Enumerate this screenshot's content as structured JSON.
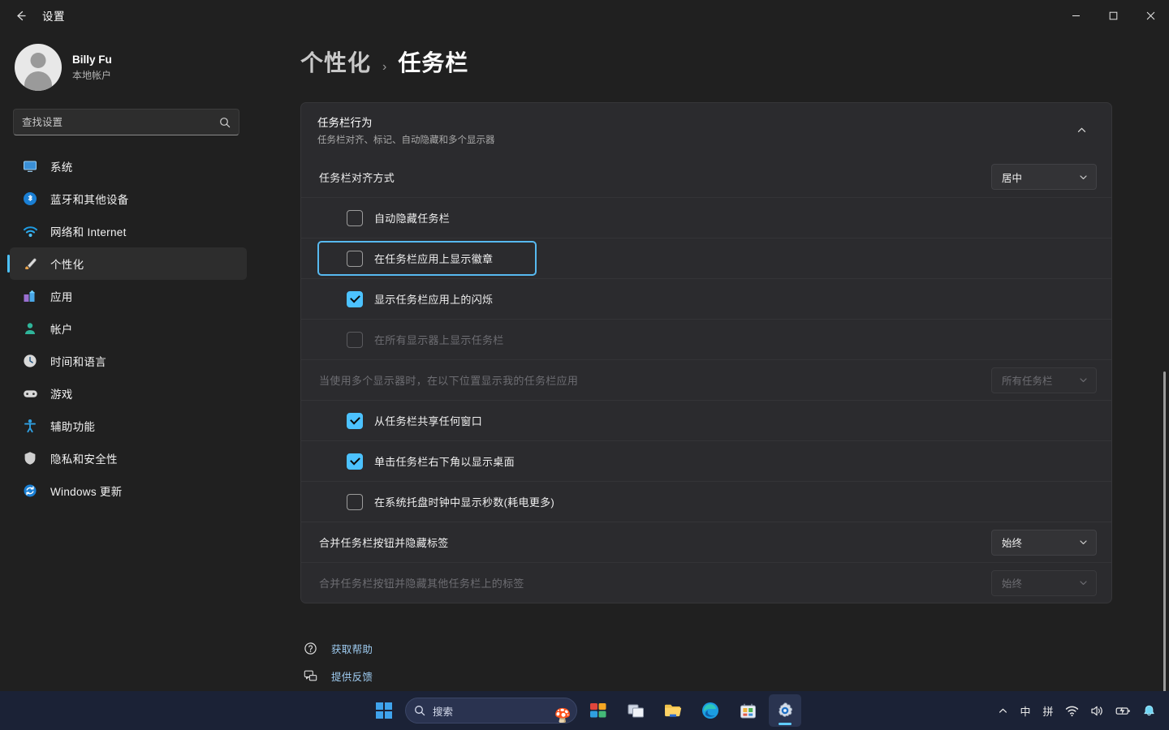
{
  "window": {
    "title": "设置",
    "back_label": "返回",
    "minimize_label": "最小化",
    "maximize_label": "最大化",
    "close_label": "关闭"
  },
  "sidebar": {
    "profile": {
      "name": "Billy Fu",
      "account_type": "本地帐户"
    },
    "search": {
      "placeholder": "查找设置",
      "value": "",
      "icon": "search-icon"
    },
    "items": [
      {
        "label": "系统",
        "icon": "system-icon",
        "selected": false
      },
      {
        "label": "蓝牙和其他设备",
        "icon": "bluetooth-icon",
        "selected": false
      },
      {
        "label": "网络和 Internet",
        "icon": "network-icon",
        "selected": false
      },
      {
        "label": "个性化",
        "icon": "personalization-icon",
        "selected": true
      },
      {
        "label": "应用",
        "icon": "apps-icon",
        "selected": false
      },
      {
        "label": "帐户",
        "icon": "accounts-icon",
        "selected": false
      },
      {
        "label": "时间和语言",
        "icon": "time-language-icon",
        "selected": false
      },
      {
        "label": "游戏",
        "icon": "gaming-icon",
        "selected": false
      },
      {
        "label": "辅助功能",
        "icon": "accessibility-icon",
        "selected": false
      },
      {
        "label": "隐私和安全性",
        "icon": "privacy-security-icon",
        "selected": false
      },
      {
        "label": "Windows 更新",
        "icon": "windows-update-icon",
        "selected": false
      }
    ]
  },
  "breadcrumb": {
    "parent": "个性化",
    "separator": "›",
    "current": "任务栏"
  },
  "card": {
    "title": "任务栏行为",
    "subtitle": "任务栏对齐、标记、自动隐藏和多个显示器",
    "expander_icon": "chevron-up-icon",
    "rows": [
      {
        "kind": "dropdown",
        "label": "任务栏对齐方式",
        "value": "居中",
        "disabled": false,
        "focused": false
      },
      {
        "kind": "checkbox",
        "label": "自动隐藏任务栏",
        "checked": false,
        "disabled": false,
        "focused": false
      },
      {
        "kind": "checkbox",
        "label": "在任务栏应用上显示徽章",
        "checked": false,
        "disabled": false,
        "focused": true
      },
      {
        "kind": "checkbox",
        "label": "显示任务栏应用上的闪烁",
        "checked": true,
        "disabled": false,
        "focused": false
      },
      {
        "kind": "checkbox",
        "label": "在所有显示器上显示任务栏",
        "checked": false,
        "disabled": true,
        "focused": false
      },
      {
        "kind": "dropdown",
        "label": "当使用多个显示器时，在以下位置显示我的任务栏应用",
        "value": "所有任务栏",
        "disabled": true,
        "focused": false
      },
      {
        "kind": "checkbox",
        "label": "从任务栏共享任何窗口",
        "checked": true,
        "disabled": false,
        "focused": false
      },
      {
        "kind": "checkbox",
        "label": "单击任务栏右下角以显示桌面",
        "checked": true,
        "disabled": false,
        "focused": false
      },
      {
        "kind": "checkbox",
        "label": "在系统托盘时钟中显示秒数(耗电更多)",
        "checked": false,
        "disabled": false,
        "focused": false
      },
      {
        "kind": "dropdown",
        "label": "合并任务栏按钮并隐藏标签",
        "value": "始终",
        "disabled": false,
        "focused": false
      },
      {
        "kind": "dropdown",
        "label": "合并任务栏按钮并隐藏其他任务栏上的标签",
        "value": "始终",
        "disabled": true,
        "focused": false
      }
    ]
  },
  "footer": {
    "links": [
      {
        "label": "获取帮助",
        "icon": "help-icon"
      },
      {
        "label": "提供反馈",
        "icon": "feedback-icon"
      }
    ]
  },
  "taskbar": {
    "start_label": "开始",
    "search": {
      "placeholder": "搜索",
      "icon": "search-icon"
    },
    "apps": [
      {
        "name": "widgets-icon",
        "label": "小组件"
      },
      {
        "name": "task-view-icon",
        "label": "任务视图"
      },
      {
        "name": "file-explorer-icon",
        "label": "文件资源管理器"
      },
      {
        "name": "edge-icon",
        "label": "Microsoft Edge"
      },
      {
        "name": "store-icon",
        "label": "Microsoft Store"
      },
      {
        "name": "settings-icon",
        "label": "设置",
        "active": true
      }
    ],
    "tray": [
      {
        "name": "chevron-up-icon",
        "glyph": "⌃"
      },
      {
        "name": "ime-mode-icon",
        "glyph": "中"
      },
      {
        "name": "ime-pinyin-icon",
        "glyph": "拼"
      },
      {
        "name": "wifi-icon",
        "glyph": ""
      },
      {
        "name": "volume-icon",
        "glyph": ""
      },
      {
        "name": "battery-icon",
        "glyph": ""
      },
      {
        "name": "notification-bell-icon",
        "glyph": ""
      }
    ]
  },
  "colors": {
    "accent": "#4cc2ff",
    "focus_ring": "#57b9f0",
    "window_bg": "#202020",
    "card_bg": "#2b2b2e",
    "taskbar_bg": "#1b2236",
    "link": "#9ecbf0",
    "disabled_text": "#6d6d72"
  }
}
